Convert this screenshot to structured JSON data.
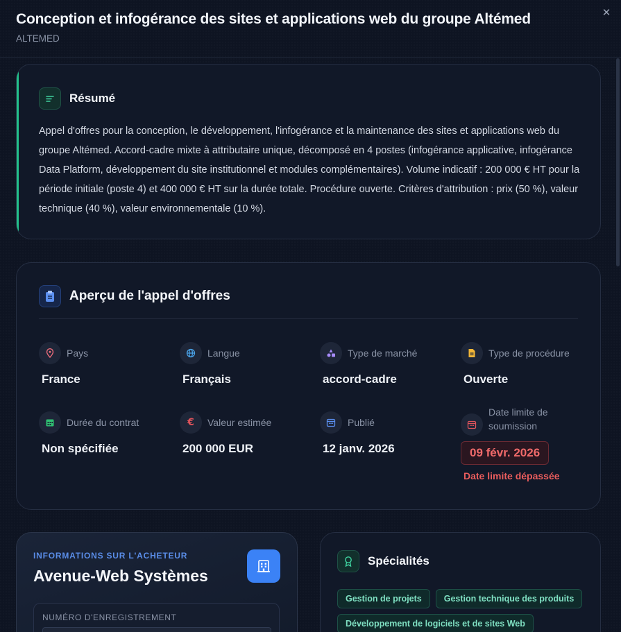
{
  "header": {
    "title": "Conception et infogérance des sites et applications web du groupe Altémed",
    "subtitle": "ALTEMED",
    "close_icon": "close-icon"
  },
  "summary": {
    "title": "Résumé",
    "icon": "text-lines-icon",
    "text": "Appel d'offres pour la conception, le développement, l'infogérance et la maintenance des sites et applications web du groupe Altémed. Accord-cadre mixte à attributaire unique, décomposé en 4 postes (infogérance applicative, infogérance Data Platform, développement du site institutionnel et modules complémentaires). Volume indicatif : 200 000 € HT pour la période initiale (poste 4) et 400 000 € HT sur la durée totale. Procédure ouverte. Critères d'attribution : prix (50 %), valeur technique (40 %), valeur environnementale (10 %).",
    "accent_color": "#22c08a"
  },
  "overview": {
    "title": "Aperçu de l'appel d'offres",
    "icon": "clipboard-icon",
    "fields": [
      {
        "label": "Pays",
        "value": "France",
        "icon": "map-pin-icon"
      },
      {
        "label": "Langue",
        "value": "Français",
        "icon": "globe-icon"
      },
      {
        "label": "Type de marché",
        "value": "accord-cadre",
        "icon": "shapes-icon"
      },
      {
        "label": "Type de procédure",
        "value": "Ouverte",
        "icon": "document-icon"
      },
      {
        "label": "Durée du contrat",
        "value": "Non spécifiée",
        "icon": "calendar-grid-icon"
      },
      {
        "label": "Valeur estimée",
        "value": "200 000 EUR",
        "icon": "euro-icon"
      },
      {
        "label": "Publié",
        "value": "12 janv. 2026",
        "icon": "calendar-icon"
      },
      {
        "label": "Date limite de soumission",
        "value": "09 févr. 2026",
        "icon": "calendar-alert-icon"
      }
    ],
    "deadline_note": "Date limite dépassée",
    "deadline_color": "#f06a6a"
  },
  "buyer": {
    "kicker": "INFORMATIONS SUR L'ACHETEUR",
    "name": "Avenue-Web Systèmes",
    "icon": "building-icon",
    "registration_label": "NUMÉRO D'ENREGISTREMENT"
  },
  "specialties": {
    "title": "Spécialités",
    "icon": "award-icon",
    "tags": [
      "Gestion de projets",
      "Gestion technique des produits",
      "Développement de logiciels et de sites Web"
    ]
  }
}
